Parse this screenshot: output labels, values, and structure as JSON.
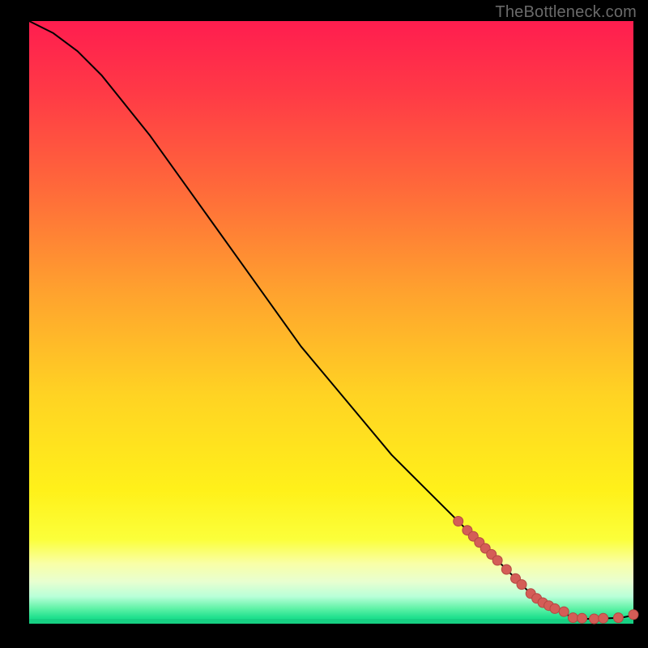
{
  "watermark": {
    "text": "TheBottleneck.com"
  },
  "plot": {
    "margin_left": 36,
    "margin_right": 18,
    "margin_top": 26,
    "margin_bottom": 30,
    "bg_black": "#000000",
    "gradient_stops": [
      {
        "offset": 0.0,
        "color": "#ff1d4f"
      },
      {
        "offset": 0.12,
        "color": "#ff3a46"
      },
      {
        "offset": 0.28,
        "color": "#ff6a3a"
      },
      {
        "offset": 0.45,
        "color": "#ffa22e"
      },
      {
        "offset": 0.62,
        "color": "#ffd323"
      },
      {
        "offset": 0.78,
        "color": "#fff11a"
      },
      {
        "offset": 0.86,
        "color": "#fbff3a"
      },
      {
        "offset": 0.9,
        "color": "#f9ffa6"
      },
      {
        "offset": 0.93,
        "color": "#e8ffd0"
      },
      {
        "offset": 0.955,
        "color": "#b8ffd8"
      },
      {
        "offset": 0.975,
        "color": "#5ef2a6"
      },
      {
        "offset": 0.99,
        "color": "#1fe08e"
      },
      {
        "offset": 1.0,
        "color": "#19d885"
      }
    ],
    "curve_color": "#000000",
    "curve_width": 2,
    "marker_fill": "#d45d57",
    "marker_stroke": "#b44842",
    "marker_r": 6
  },
  "chart_data": {
    "type": "line",
    "title": "",
    "xlabel": "",
    "ylabel": "",
    "xlim": [
      0,
      100
    ],
    "ylim": [
      0,
      100
    ],
    "series": [
      {
        "name": "bottleneck-curve",
        "x": [
          0,
          4,
          8,
          12,
          16,
          20,
          25,
          30,
          35,
          40,
          45,
          50,
          55,
          60,
          65,
          70,
          75,
          80,
          82,
          84,
          86,
          88,
          90,
          92,
          94,
          96,
          98,
          100
        ],
        "y": [
          100,
          98,
          95,
          91,
          86,
          81,
          74,
          67,
          60,
          53,
          46,
          40,
          34,
          28,
          23,
          18,
          13,
          8,
          6,
          4,
          3,
          2,
          1.0,
          0.8,
          0.8,
          0.9,
          1.0,
          1.4
        ]
      }
    ],
    "markers": {
      "name": "highlighted-points",
      "x": [
        71,
        72.5,
        73.5,
        74.5,
        75.5,
        76.5,
        77.5,
        79,
        80.5,
        81.5,
        83,
        84,
        85,
        86,
        87,
        88.5,
        90,
        91.5,
        93.5,
        95,
        97.5,
        100
      ],
      "y": [
        17,
        15.5,
        14.5,
        13.5,
        12.5,
        11.5,
        10.5,
        9,
        7.5,
        6.5,
        5,
        4.2,
        3.5,
        3.0,
        2.5,
        2.0,
        1.0,
        0.9,
        0.8,
        0.9,
        1.0,
        1.5
      ]
    }
  }
}
